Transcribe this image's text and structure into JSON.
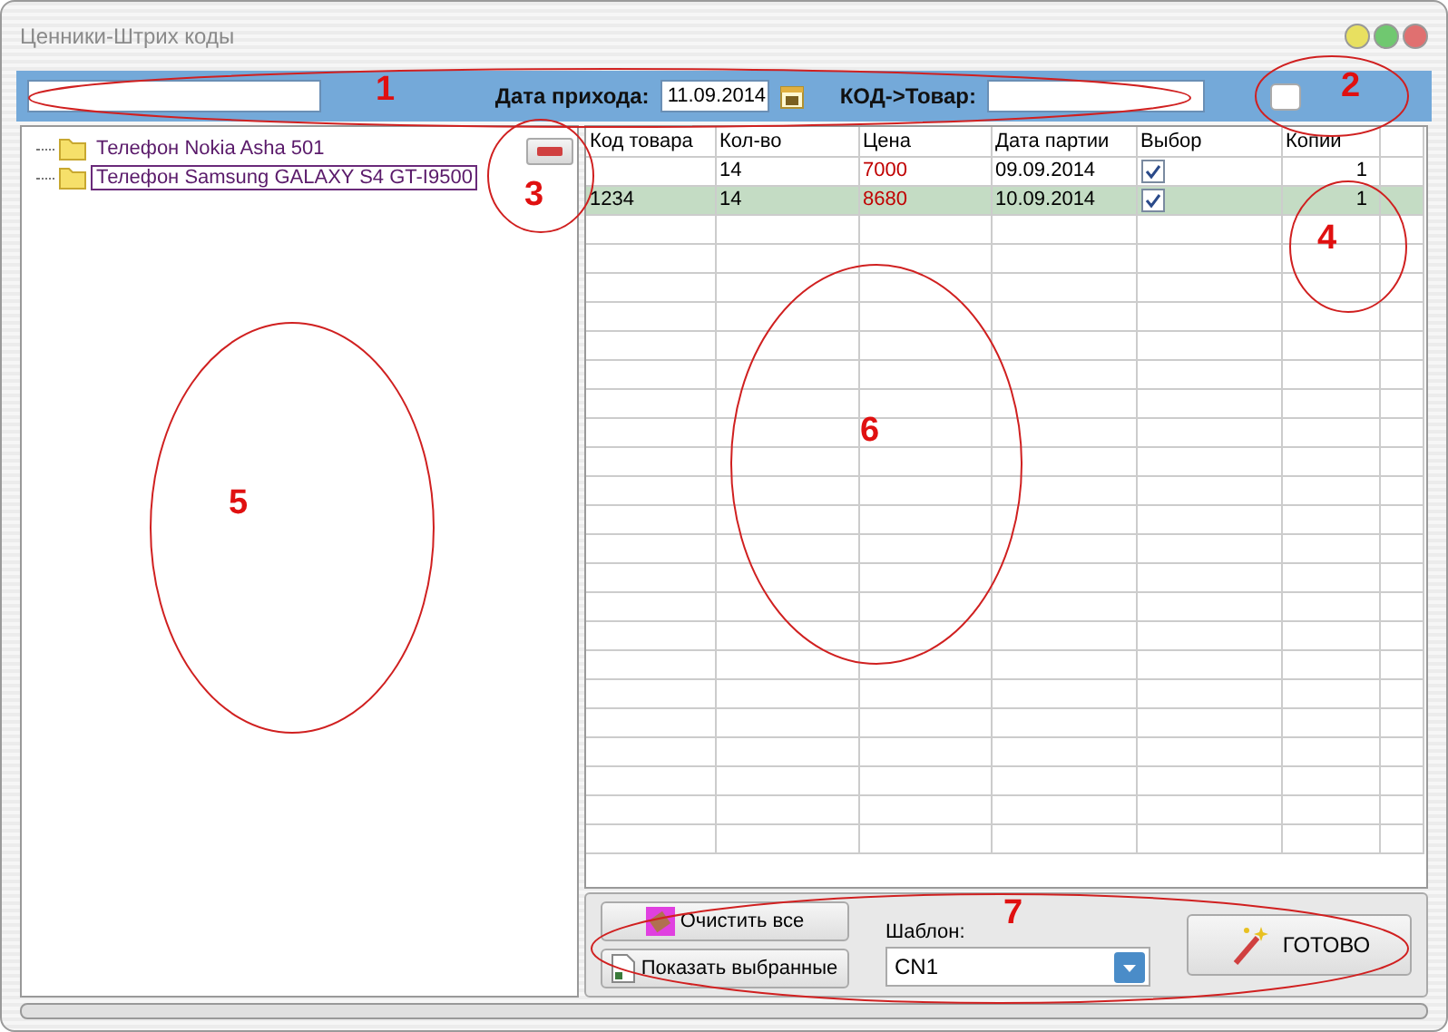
{
  "window": {
    "title": "Ценники-Штрих коды"
  },
  "toolbar": {
    "date_label": "Дата прихода:",
    "date_value": "11.09.2014",
    "code_label": "КОД->Товар:"
  },
  "tree": {
    "items": [
      {
        "label": "Телефон Nokia Asha 501",
        "selected": false
      },
      {
        "label": "Телефон Samsung GALAXY S4 GT-I9500",
        "selected": true
      }
    ]
  },
  "table": {
    "columns": [
      "Код товара",
      "Кол-во",
      "Цена",
      "Дата партии",
      "Выбор",
      "Копии"
    ],
    "rows": [
      {
        "code": "",
        "qty": "14",
        "price": "7000",
        "date": "09.09.2014",
        "checked": true,
        "copies": "1",
        "selected": false
      },
      {
        "code": "1234",
        "qty": "14",
        "price": "8680",
        "date": "10.09.2014",
        "checked": true,
        "copies": "1",
        "selected": true
      }
    ]
  },
  "bottom": {
    "clear_button": "Очистить все",
    "show_button": "Показать выбранные",
    "template_label": "Шаблон:",
    "template_value": "CN1",
    "done_button": "ГОТОВО"
  },
  "annotations": [
    {
      "label": "1"
    },
    {
      "label": "2"
    },
    {
      "label": "3"
    },
    {
      "label": "4"
    },
    {
      "label": "5"
    },
    {
      "label": "6"
    },
    {
      "label": "7"
    }
  ]
}
